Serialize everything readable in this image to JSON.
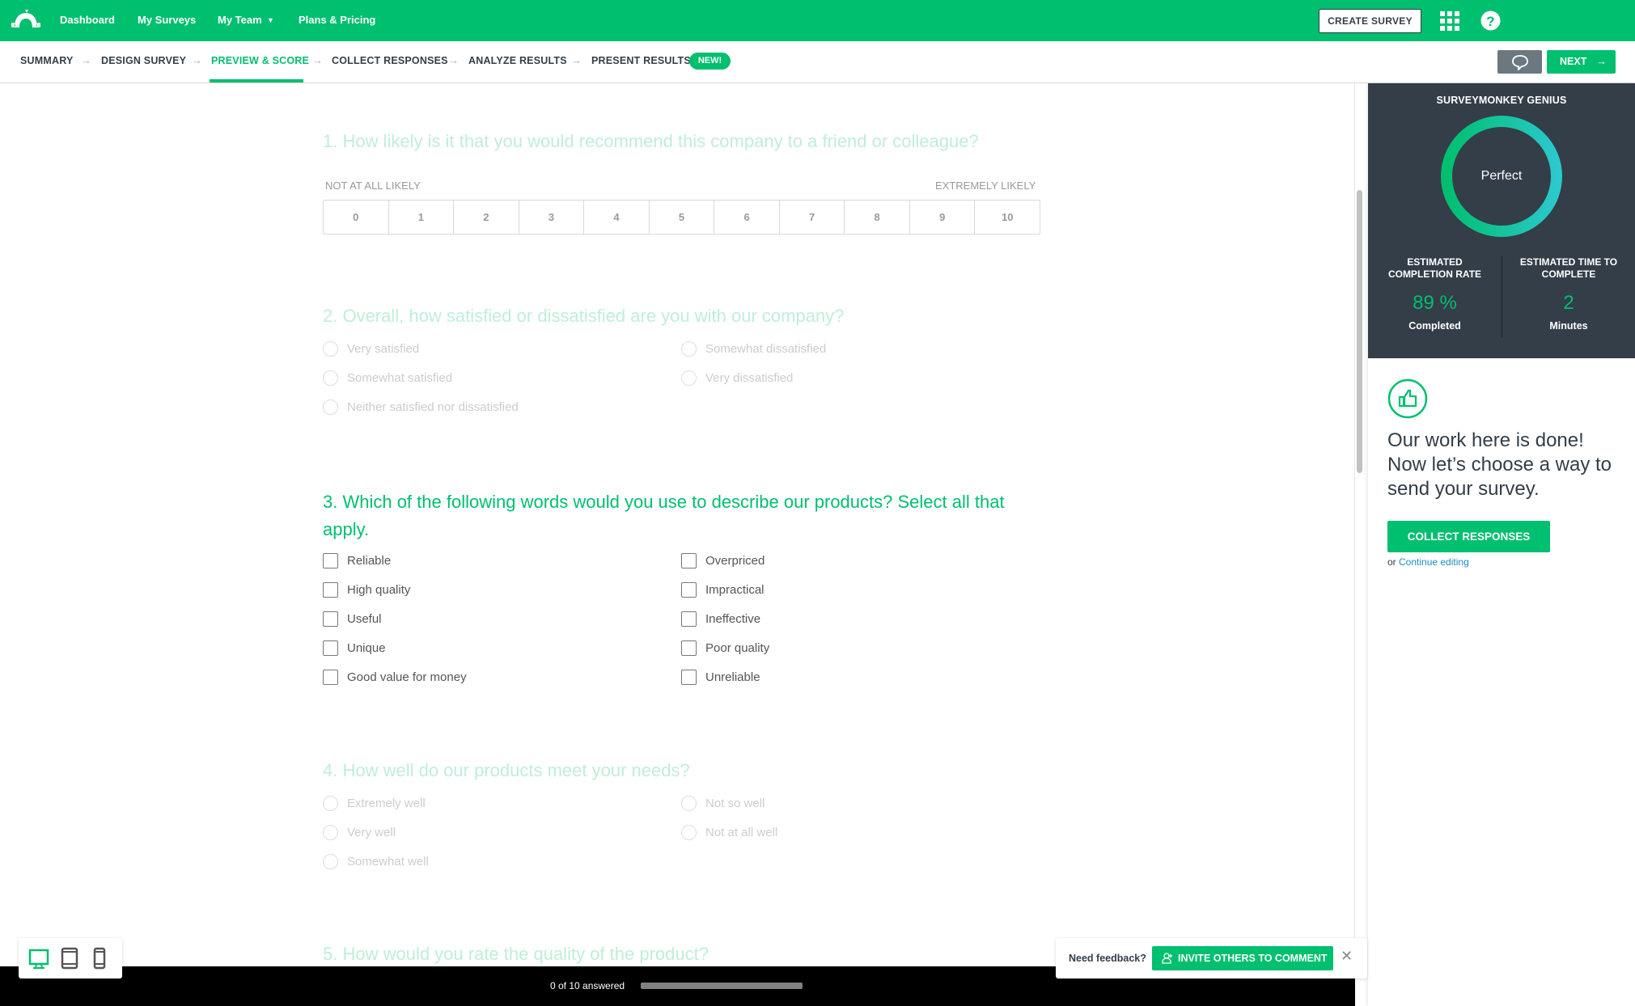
{
  "colors": {
    "brand": "#00bf6f",
    "dark_panel": "#333e48",
    "link": "#1a8dc4"
  },
  "topnav": {
    "items": [
      "Dashboard",
      "My Surveys",
      "My Team",
      "Plans & Pricing"
    ],
    "create_survey": "CREATE SURVEY"
  },
  "steps": {
    "items": [
      "SUMMARY",
      "DESIGN SURVEY",
      "PREVIEW & SCORE",
      "COLLECT RESPONSES",
      "ANALYZE RESULTS",
      "PRESENT RESULTS"
    ],
    "active": "PREVIEW & SCORE",
    "new_badge": "NEW!",
    "next": "NEXT"
  },
  "questions": {
    "q1": {
      "title": "1. How likely is it that you would recommend this company to a friend or colleague?",
      "low_label": "NOT AT ALL LIKELY",
      "high_label": "EXTREMELY LIKELY",
      "scale": [
        "0",
        "1",
        "2",
        "3",
        "4",
        "5",
        "6",
        "7",
        "8",
        "9",
        "10"
      ]
    },
    "q2": {
      "title": "2. Overall, how satisfied or dissatisfied are you with our company?",
      "options": [
        "Very satisfied",
        "Somewhat satisfied",
        "Neither satisfied nor dissatisfied",
        "Somewhat dissatisfied",
        "Very dissatisfied"
      ]
    },
    "q3": {
      "title": "3. Which of the following words would you use to describe our products? Select all that apply.",
      "options": [
        "Reliable",
        "High quality",
        "Useful",
        "Unique",
        "Good value for money",
        "Overpriced",
        "Impractical",
        "Ineffective",
        "Poor quality",
        "Unreliable"
      ]
    },
    "q4": {
      "title": "4. How well do our products meet your needs?",
      "options": [
        "Extremely well",
        "Very well",
        "Somewhat well",
        "Not so well",
        "Not at all well"
      ]
    },
    "q5": {
      "title": "5. How would you rate the quality of the product?"
    }
  },
  "progress": {
    "text": "0 of 10 answered",
    "fraction": 0
  },
  "genius": {
    "title": "SURVEYMONKEY GENIUS",
    "score": "Perfect",
    "completion_label": "ESTIMATED COMPLETION RATE",
    "completion_value": "89 %",
    "completion_sub": "Completed",
    "time_label": "ESTIMATED TIME TO COMPLETE",
    "time_value": "2",
    "time_sub": "Minutes"
  },
  "done": {
    "message": "Our work here is done! Now let’s choose a way to send your survey.",
    "button": "COLLECT RESPONSES",
    "or": "or",
    "continue": "Continue editing"
  },
  "feedback": {
    "label": "Need feedback?",
    "button": "INVITE OTHERS TO COMMENT"
  }
}
